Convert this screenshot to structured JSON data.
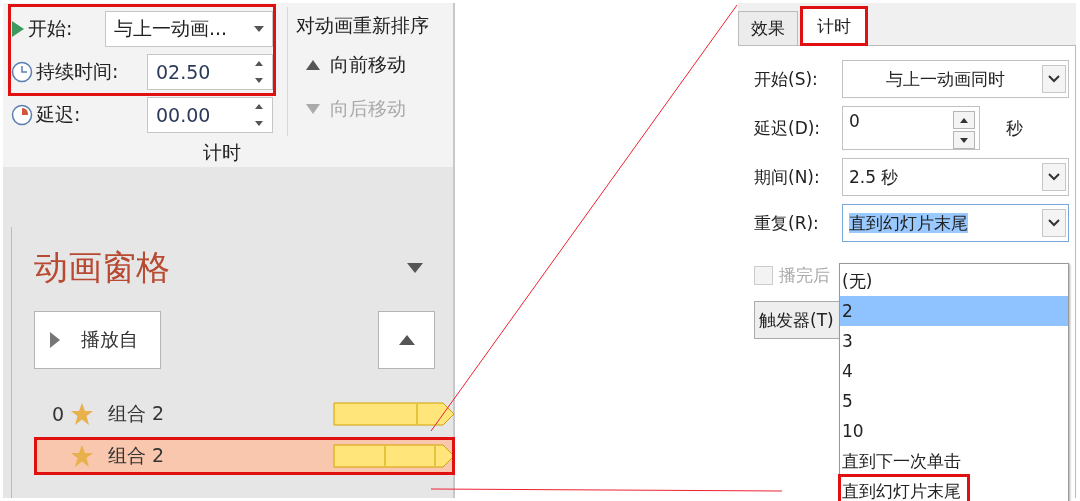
{
  "ribbon": {
    "rows": [
      {
        "kind": "combo",
        "label": "开始:",
        "value": "与上一动画...",
        "highlighted": true
      },
      {
        "kind": "spinner",
        "label": "持续时间:",
        "value": "02.50",
        "highlighted": true
      },
      {
        "kind": "spinner",
        "label": "延迟:",
        "value": "00.00",
        "highlighted": false
      }
    ],
    "reorder_title": "对动画重新排序",
    "reorder_buttons": [
      {
        "label": "向前移动",
        "kind": "up",
        "disabled": false
      },
      {
        "label": "向后移动",
        "kind": "down",
        "disabled": true
      }
    ],
    "group_label": "计时"
  },
  "animation_pane": {
    "title": "动画窗格",
    "play_button": "播放自",
    "items": [
      {
        "order": "0",
        "name": "组合 2",
        "selected": false,
        "highlighted": false
      },
      {
        "name": "组合 2",
        "selected": true,
        "highlighted": true
      }
    ]
  },
  "dialog": {
    "tabs": [
      {
        "label": "效果",
        "selected": false,
        "highlighted": false
      },
      {
        "label": "计时",
        "selected": true,
        "highlighted": true
      }
    ],
    "fields": [
      {
        "kind": "combo",
        "label": "开始(S):",
        "value": "与上一动画同时",
        "centered": true
      },
      {
        "kind": "spinner",
        "label": "延迟(D):",
        "value": "0",
        "unit": "秒"
      },
      {
        "kind": "combo",
        "label": "期间(N):",
        "value": "2.5 秒"
      },
      {
        "kind": "combo",
        "label": "重复(R):",
        "value": "直到幻灯片末尾",
        "open": true
      }
    ],
    "checkbox": {
      "label": "播完后",
      "checked": false,
      "disabled": true
    },
    "trigger_button": "触发器(T)",
    "dropdown_options": [
      {
        "label": "(无)",
        "selected": false,
        "highlighted": false
      },
      {
        "label": "2",
        "selected": true,
        "highlighted": false
      },
      {
        "label": "3",
        "selected": false,
        "highlighted": false
      },
      {
        "label": "4",
        "selected": false,
        "highlighted": false
      },
      {
        "label": "5",
        "selected": false,
        "highlighted": false
      },
      {
        "label": "10",
        "selected": false,
        "highlighted": false
      },
      {
        "label": "直到下一次单击",
        "selected": false,
        "highlighted": false
      },
      {
        "label": "直到幻灯片末尾",
        "selected": false,
        "highlighted": true
      }
    ]
  }
}
